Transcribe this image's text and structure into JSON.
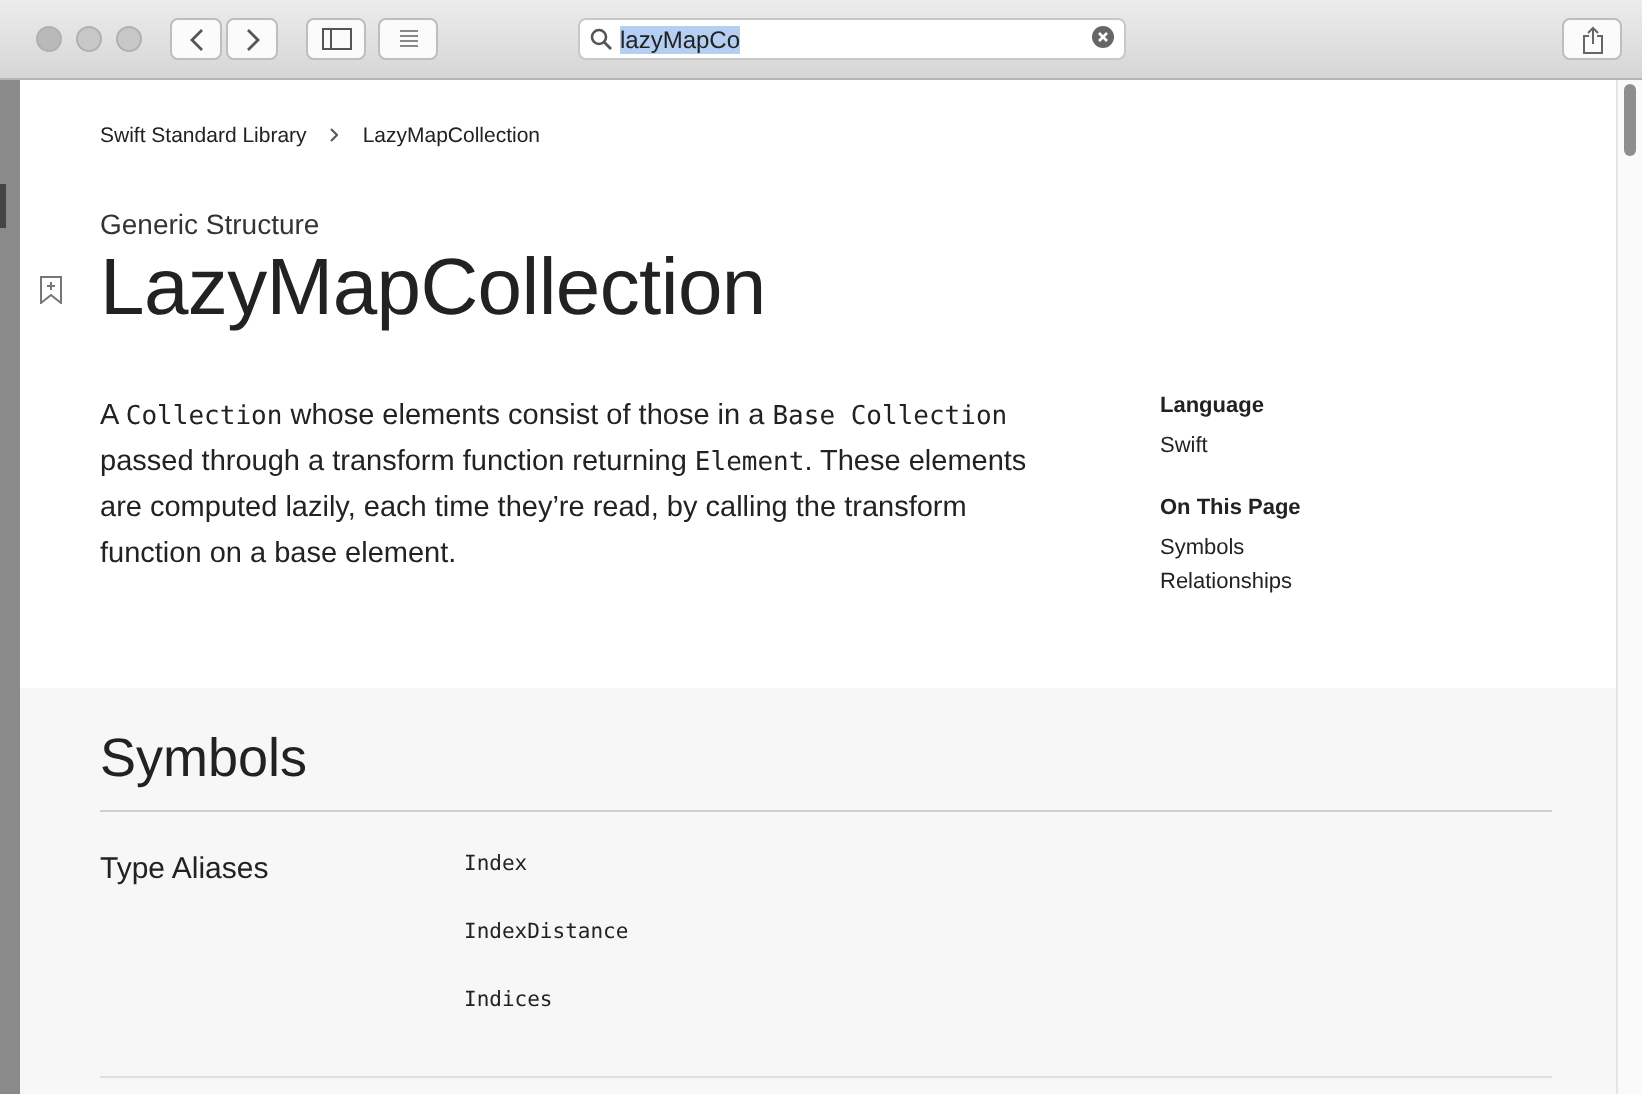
{
  "toolbar": {
    "search": {
      "value": "lazyMapCo",
      "selected": true
    }
  },
  "breadcrumb": [
    "Swift Standard Library",
    "LazyMapCollection"
  ],
  "eyebrow": "Generic Structure",
  "title": "LazyMapCollection",
  "abstract": [
    {
      "kind": "text",
      "text": "A "
    },
    {
      "kind": "code",
      "text": "Collection"
    },
    {
      "kind": "text",
      "text": " whose elements consist of those in a "
    },
    {
      "kind": "code",
      "text": "Base Collection"
    },
    {
      "kind": "text",
      "text": " passed through a transform function returning "
    },
    {
      "kind": "code",
      "text": "Element"
    },
    {
      "kind": "text",
      "text": ". These elements are computed lazily, each time they’re read, by calling the transform function on a base element."
    }
  ],
  "summary": [
    {
      "heading": "Language",
      "links": [
        "Swift"
      ]
    },
    {
      "heading": "On This Page",
      "links": [
        "Symbols",
        "Relationships"
      ]
    }
  ],
  "symbols": {
    "heading": "Symbols",
    "groups": [
      {
        "label": "Type Aliases",
        "items": [
          "Index",
          "IndexDistance",
          "Indices"
        ]
      }
    ]
  }
}
